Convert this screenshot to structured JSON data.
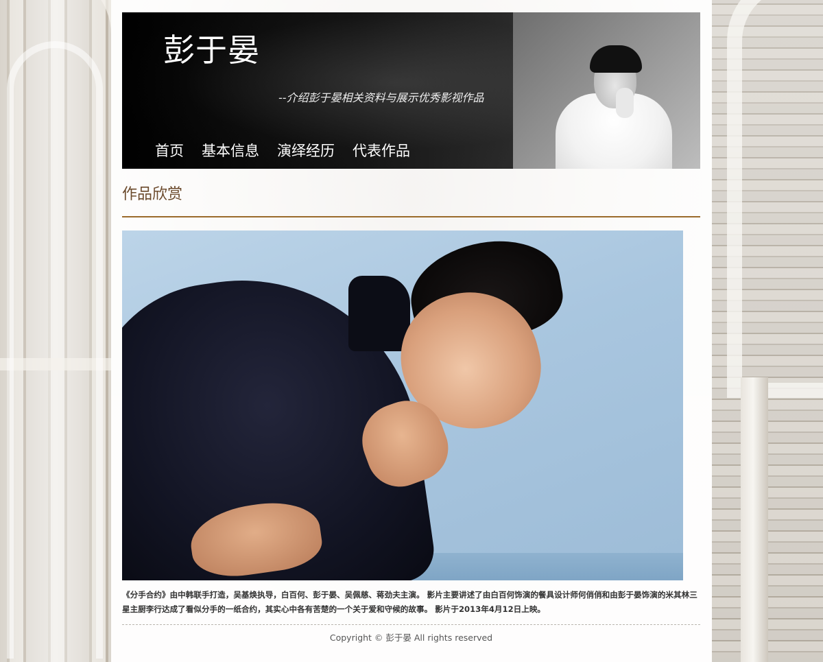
{
  "header": {
    "title": "彭于晏",
    "subtitle": "--介绍彭于晏相关资料与展示优秀影视作品"
  },
  "nav": {
    "items": [
      {
        "label": "首页"
      },
      {
        "label": "基本信息"
      },
      {
        "label": "演绎经历"
      },
      {
        "label": "代表作品"
      }
    ]
  },
  "main": {
    "section_title": "作品欣赏",
    "caption": "《分手合约》由中韩联手打造，吴基焕执导，白百何、彭于晏、吴佩慈、蒋劲夫主演。 影片主要讲述了由白百何饰演的餐具设计师何俏俏和由彭于晏饰演的米其林三星主厨李行达成了看似分手的一纸合约，其实心中各有苦楚的一个关于爱和守候的故事。 影片于2013年4月12日上映。"
  },
  "footer": {
    "copyright": "Copyright © 彭于晏 All rights reserved"
  },
  "colors": {
    "header_bg": "#0a0a0a",
    "section_title": "#6b4a2c",
    "accent_rule": "#9a6a2a",
    "photo_bg": "#a9c6df"
  }
}
